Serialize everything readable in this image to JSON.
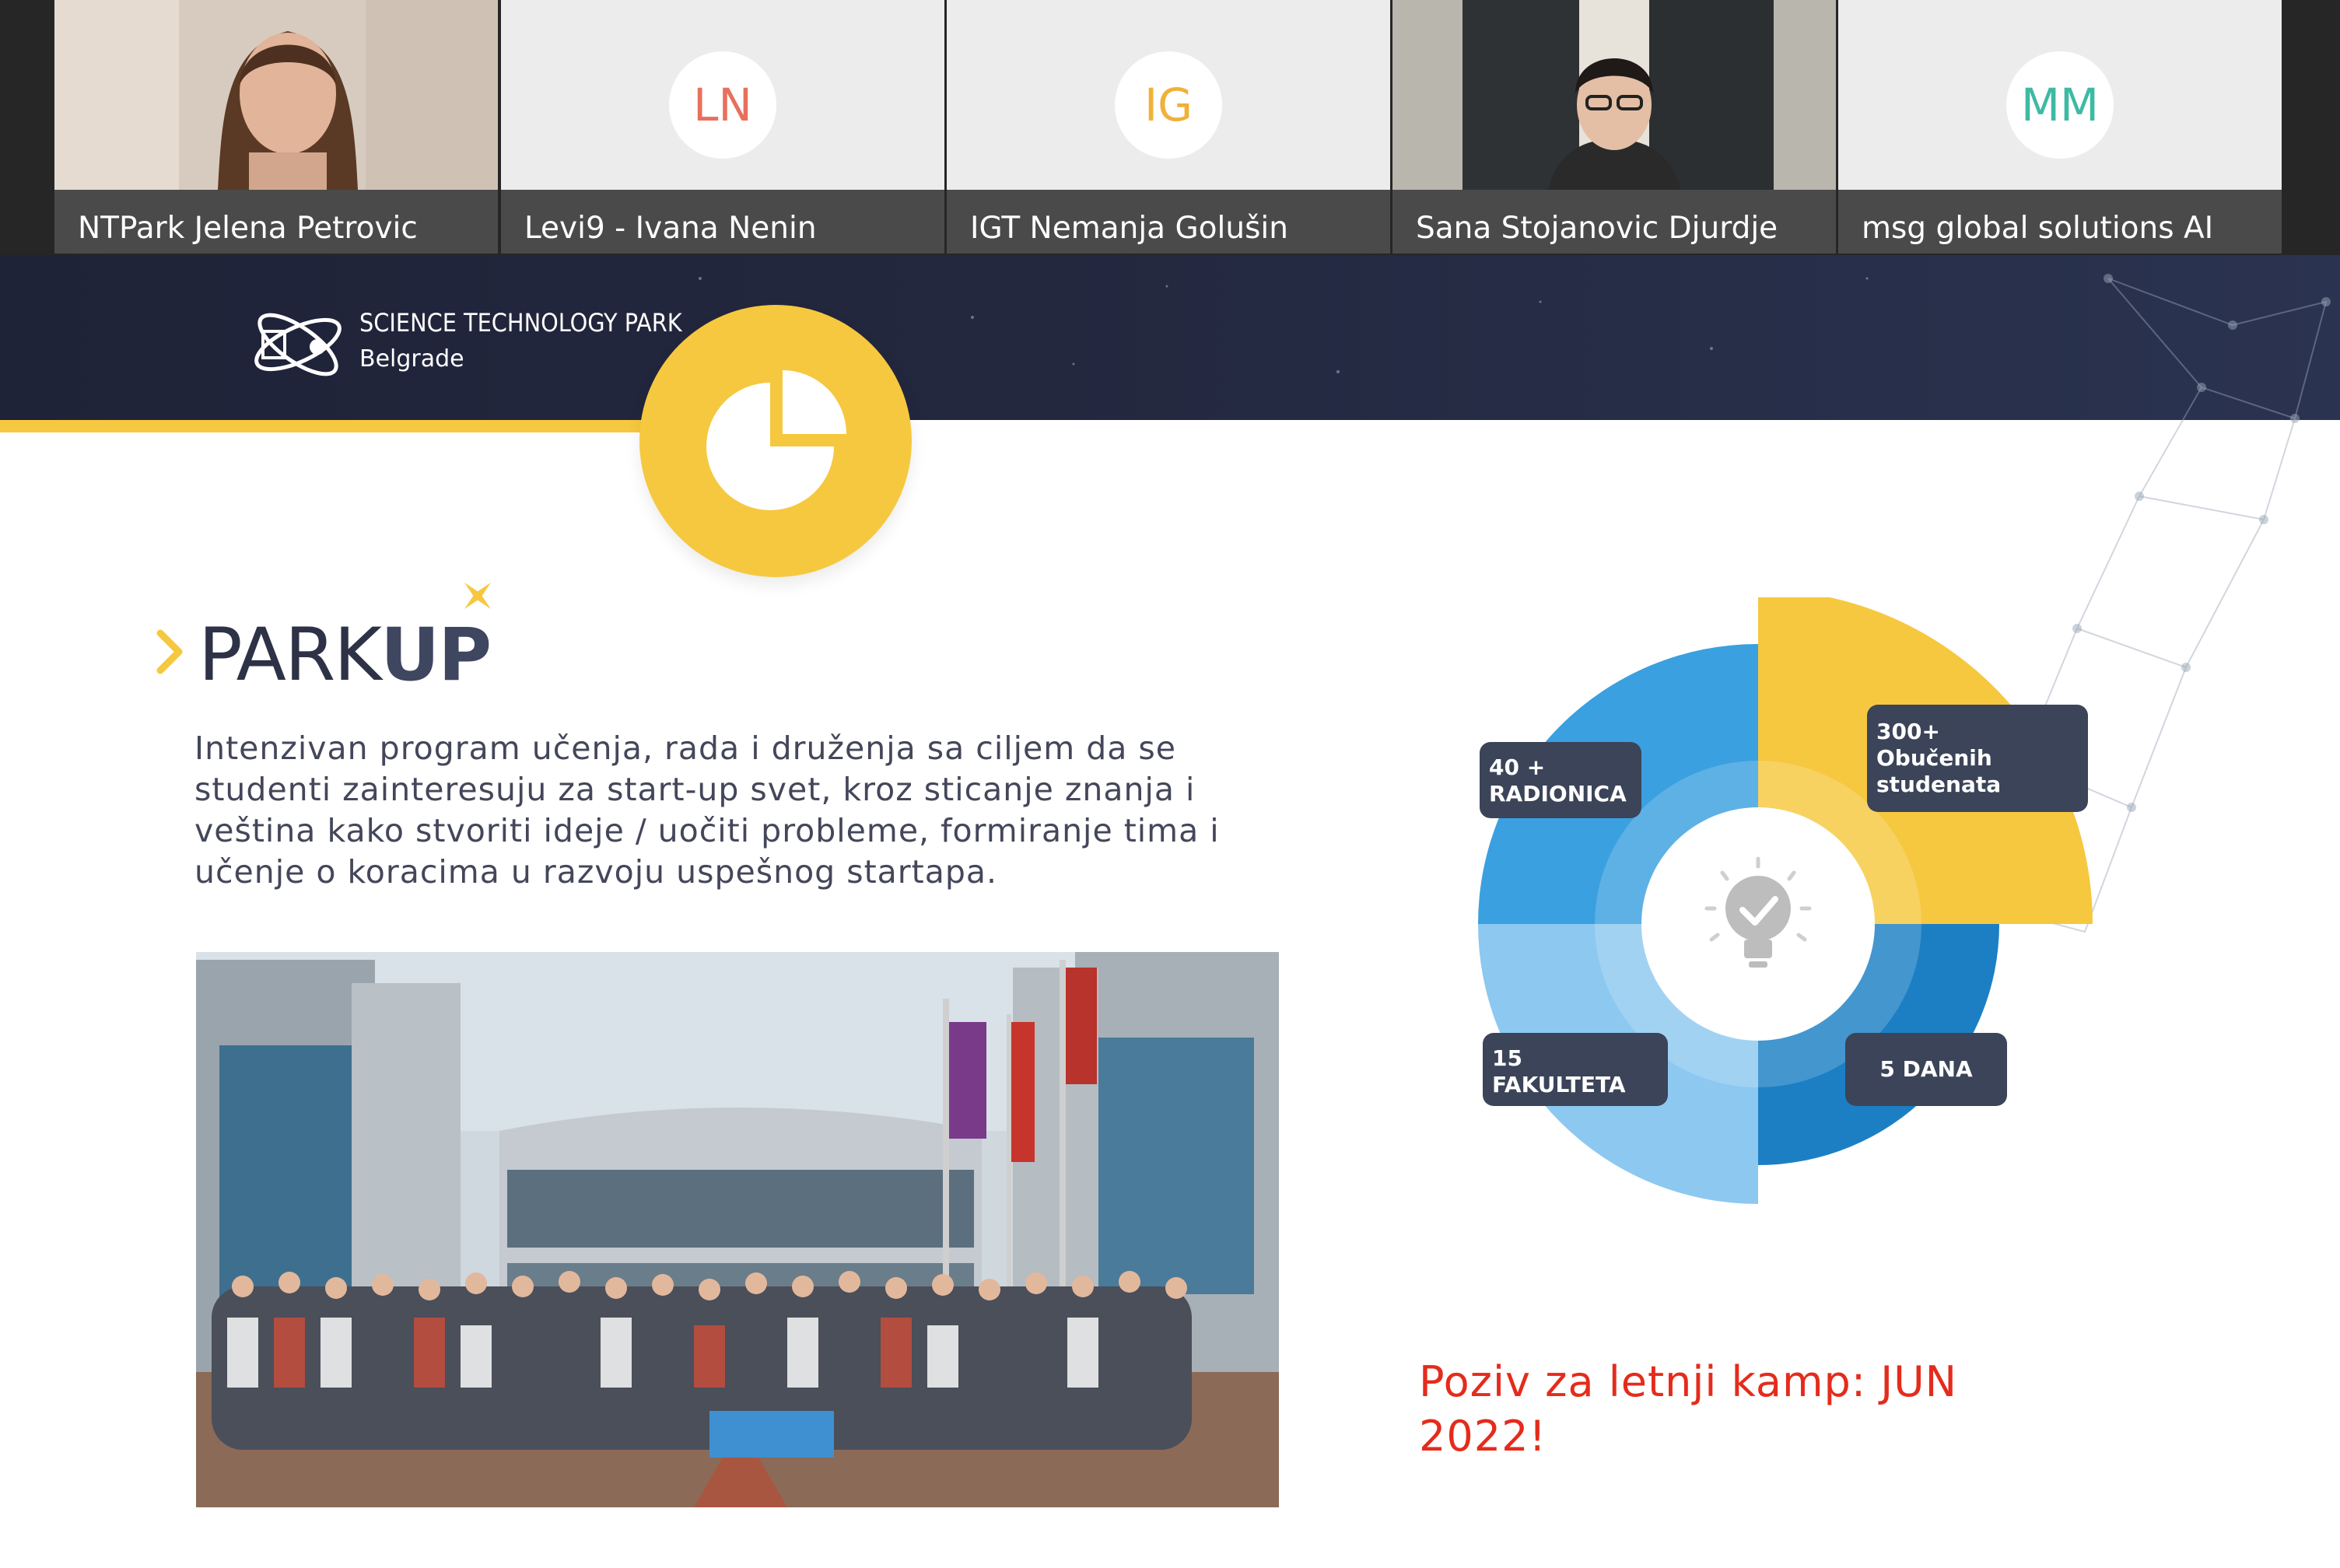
{
  "participants": [
    {
      "name": "NTPark Jelena Petrovic",
      "type": "video"
    },
    {
      "name": "Levi9 - Ivana Nenin",
      "initials": "LN",
      "color": "#e8705d",
      "type": "avatar"
    },
    {
      "name": "IGT Nemanja Golušin",
      "initials": "IG",
      "color": "#f0b13a",
      "type": "avatar"
    },
    {
      "name": "Sana Stojanovic Djurdje",
      "type": "video"
    },
    {
      "name": "msg global solutions AI",
      "initials": "MM",
      "color": "#3ebaa3",
      "type": "avatar"
    }
  ],
  "slide": {
    "logo_line1": "SCIENCE TECHNOLOGY PARK",
    "logo_line2": "Belgrade",
    "park_name_a": "PARK",
    "park_name_b": "UP",
    "description": "Intenzivan program učenja, rada i druženja sa ciljem da se studenti zainteresuju za start-up svet, kroz sticanje znanja i veština kako stvoriti ideje / uočiti probleme, formiranje tima i učenje o koracima u razvoju uspešnog startapa.",
    "call_to_action": "Poziv za letnji kamp: JUN 2022!",
    "stats": {
      "radionica_line1": "40 +",
      "radionica_line2": "RADIONICA",
      "studenti_line1": "300+",
      "studenti_line2": "Obučenih",
      "studenti_line3": "studenata",
      "fakulteta_line1": "15",
      "fakulteta_line2": "FAKULTETA",
      "dana": "5 DANA"
    }
  },
  "colors": {
    "banner": "#1f2338",
    "yellow": "#f6c83f",
    "blue_light": "#3aa0e0",
    "blue_pale": "#8dc8f0",
    "blue_dark": "#1c7fc4",
    "stat_box": "#3b4458",
    "cta_red": "#e52b1b"
  }
}
